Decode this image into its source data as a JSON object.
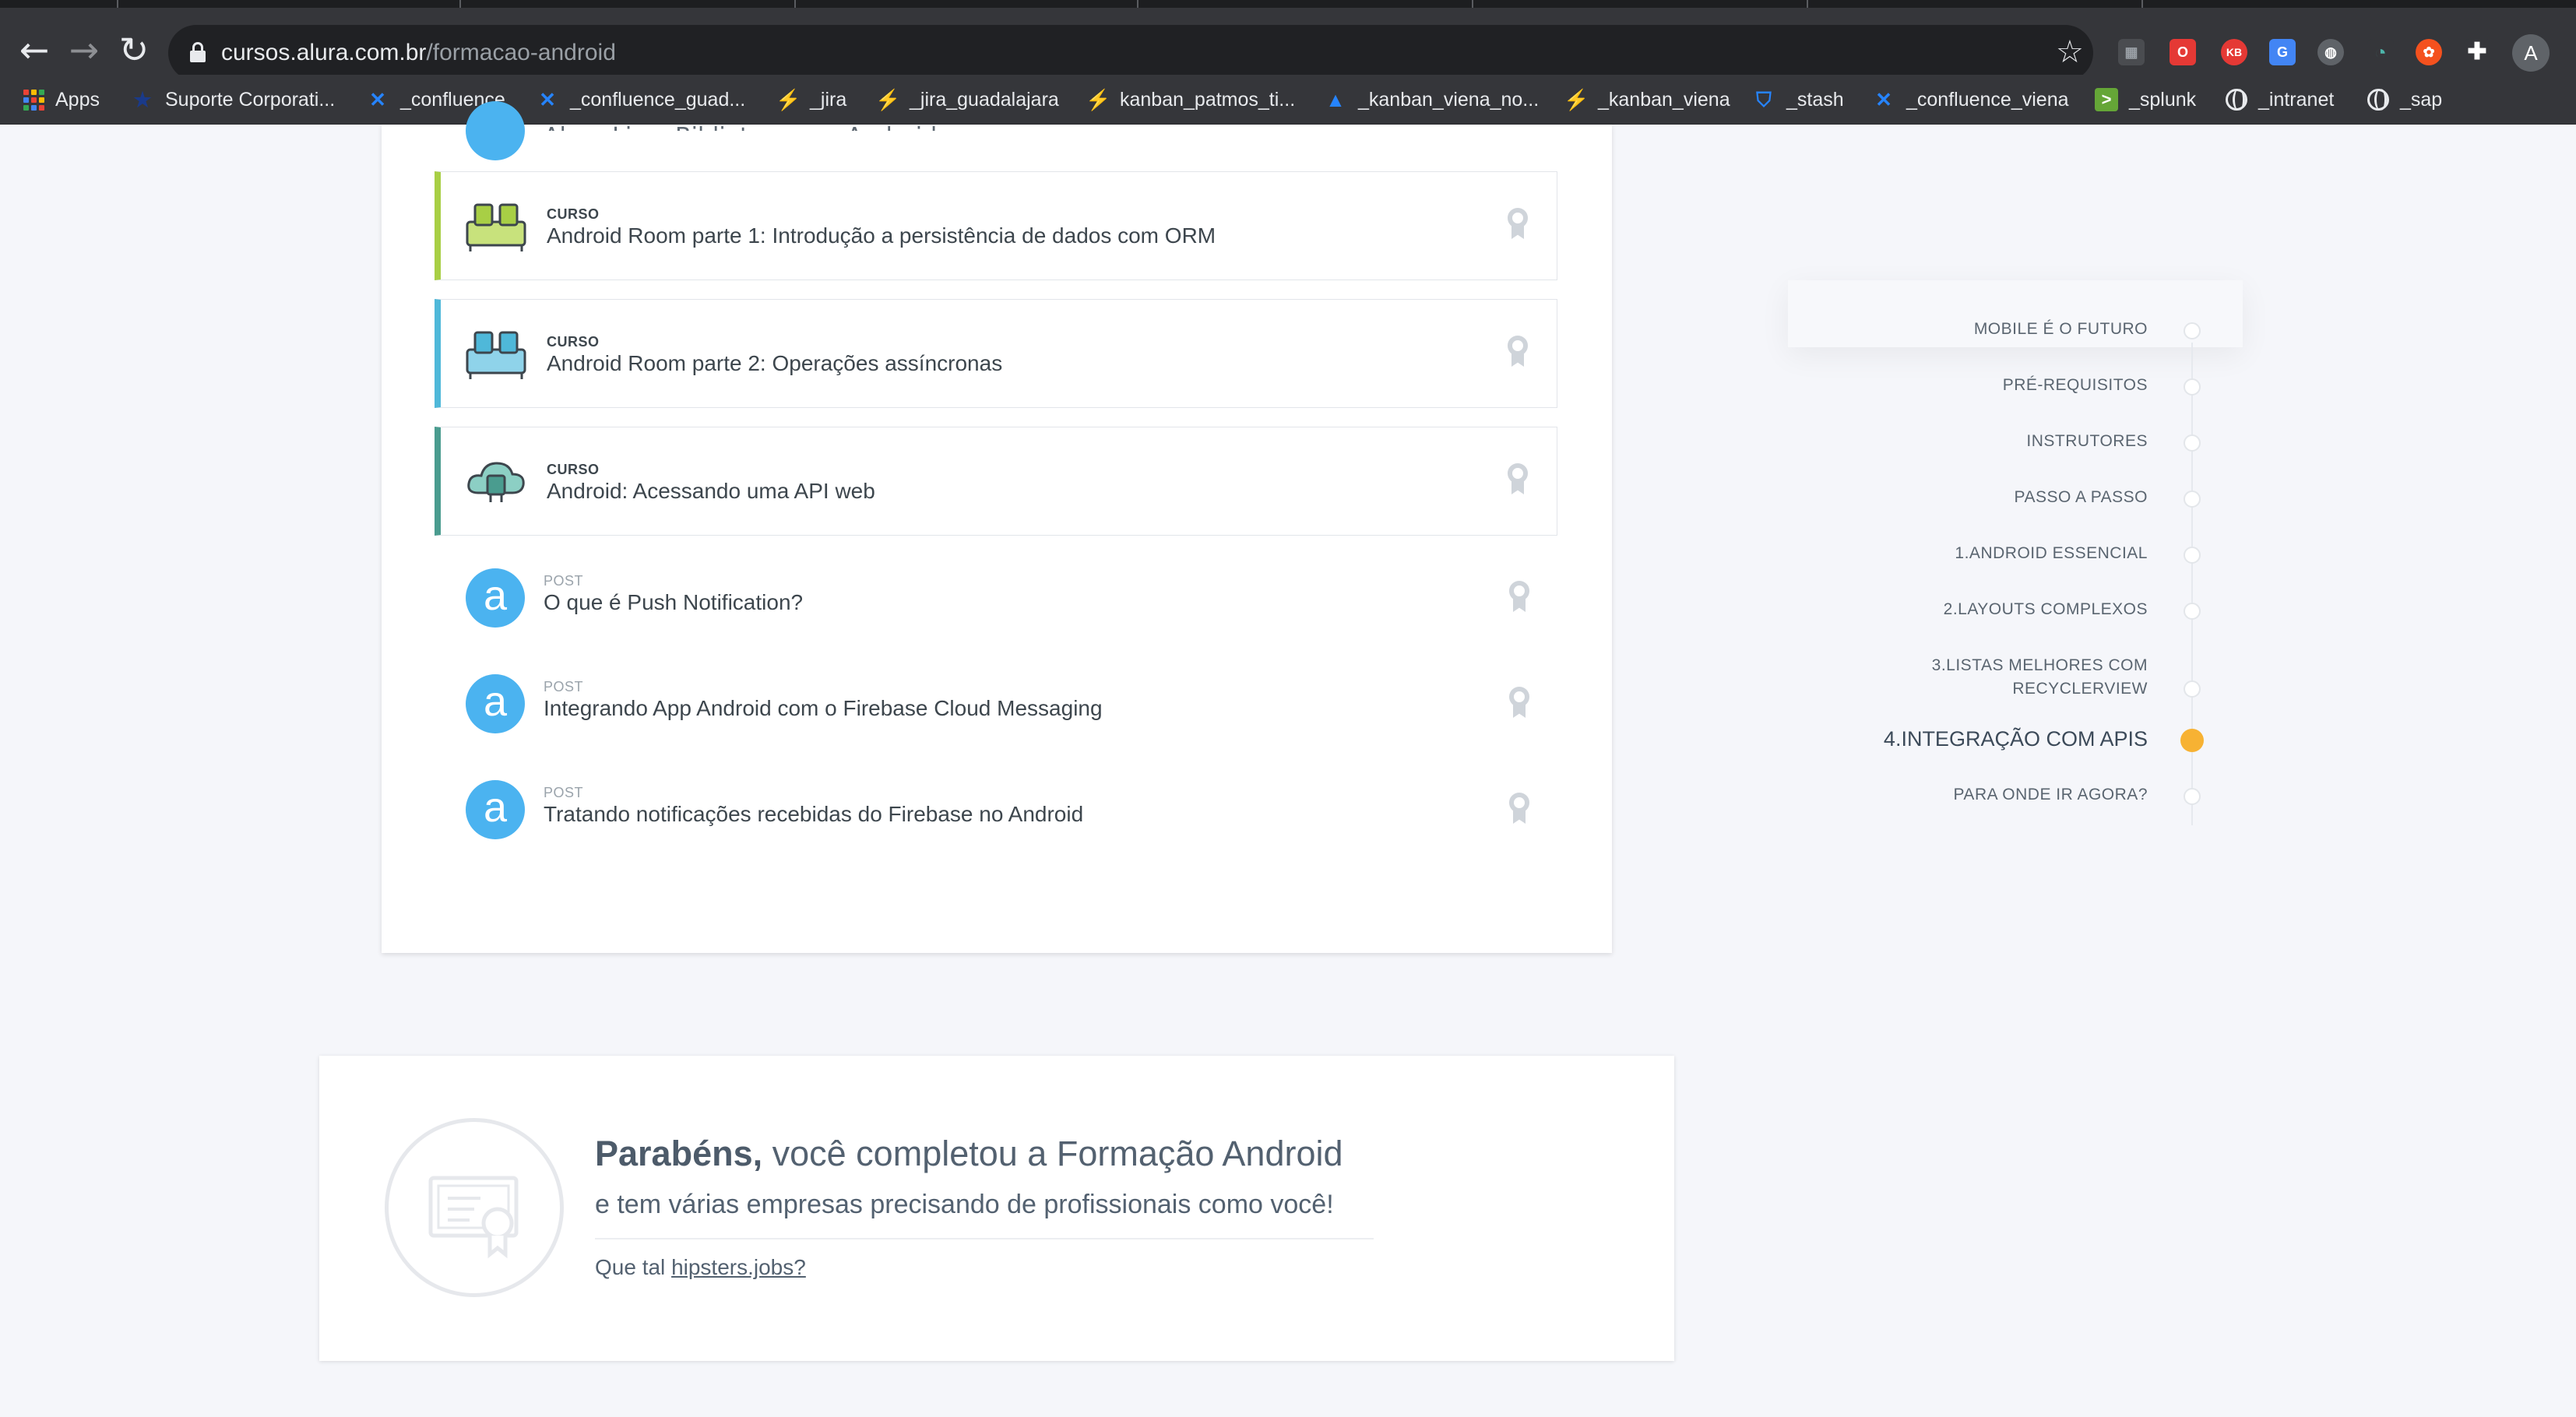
{
  "browser": {
    "url_host": "cursos.alura.com.br",
    "url_path": "/formacao-android",
    "bookmarks": [
      {
        "label": "Apps",
        "icon": "apps-grid-icon"
      },
      {
        "label": "Suporte Corporati...",
        "icon": "star-bookmark-icon"
      },
      {
        "label": "_confluence",
        "icon": "confluence-icon"
      },
      {
        "label": "_confluence_guad...",
        "icon": "confluence-icon"
      },
      {
        "label": "_jira",
        "icon": "jira-icon"
      },
      {
        "label": "_jira_guadalajara",
        "icon": "jira-icon"
      },
      {
        "label": "kanban_patmos_ti...",
        "icon": "jira-icon"
      },
      {
        "label": "_kanban_viena_no...",
        "icon": "atlassian-icon"
      },
      {
        "label": "_kanban_viena",
        "icon": "jira-icon"
      },
      {
        "label": "_stash",
        "icon": "stash-icon"
      },
      {
        "label": "_confluence_viena",
        "icon": "confluence-icon"
      },
      {
        "label": "_splunk",
        "icon": "splunk-icon"
      },
      {
        "label": "_intranet",
        "icon": "globe-icon"
      },
      {
        "label": "_sap",
        "icon": "globe-icon"
      }
    ],
    "profile_initial": "A"
  },
  "list": {
    "clipped_title": "Alura Live: Bibliotecas no Android",
    "courses": [
      {
        "kind": "CURSO",
        "title": "Android Room parte 1: Introdução a persistência de dados com ORM",
        "accent": "#a8cf45"
      },
      {
        "kind": "CURSO",
        "title": "Android Room parte 2: Operações assíncronas",
        "accent": "#4fb8d9"
      },
      {
        "kind": "CURSO",
        "title": "Android: Acessando uma API web",
        "accent": "#4a9c8f"
      }
    ],
    "posts": [
      {
        "kind": "POST",
        "title": "O que é Push Notification?",
        "logo": "a"
      },
      {
        "kind": "POST",
        "title": "Integrando App Android com o Firebase Cloud Messaging",
        "logo": "a"
      },
      {
        "kind": "POST",
        "title": "Tratando notificações recebidas do Firebase no Android",
        "logo": "a"
      }
    ]
  },
  "timeline": {
    "items": [
      {
        "label": "MOBILE É O FUTURO",
        "active": false
      },
      {
        "label": "PRÉ-REQUISITOS",
        "active": false
      },
      {
        "label": "INSTRUTORES",
        "active": false
      },
      {
        "label": "PASSO A PASSO",
        "active": false
      },
      {
        "label": "1.ANDROID ESSENCIAL",
        "active": false
      },
      {
        "label": "2.LAYOUTS COMPLEXOS",
        "active": false
      },
      {
        "label_line1": "3.LISTAS MELHORES COM",
        "label_line2": "RECYCLERVIEW",
        "active": false
      },
      {
        "label": "4.INTEGRAÇÃO COM APIS",
        "active": true
      },
      {
        "label": "PARA ONDE IR AGORA?",
        "active": false
      }
    ],
    "active_color": "#f7b233"
  },
  "congrats": {
    "title_bold": "Parabéns,",
    "title_rest": " você completou a Formação Android",
    "subtitle": "e tem várias empresas precisando de profissionais como você!",
    "ask_prefix": "Que tal ",
    "ask_link": "hipsters.jobs?"
  }
}
